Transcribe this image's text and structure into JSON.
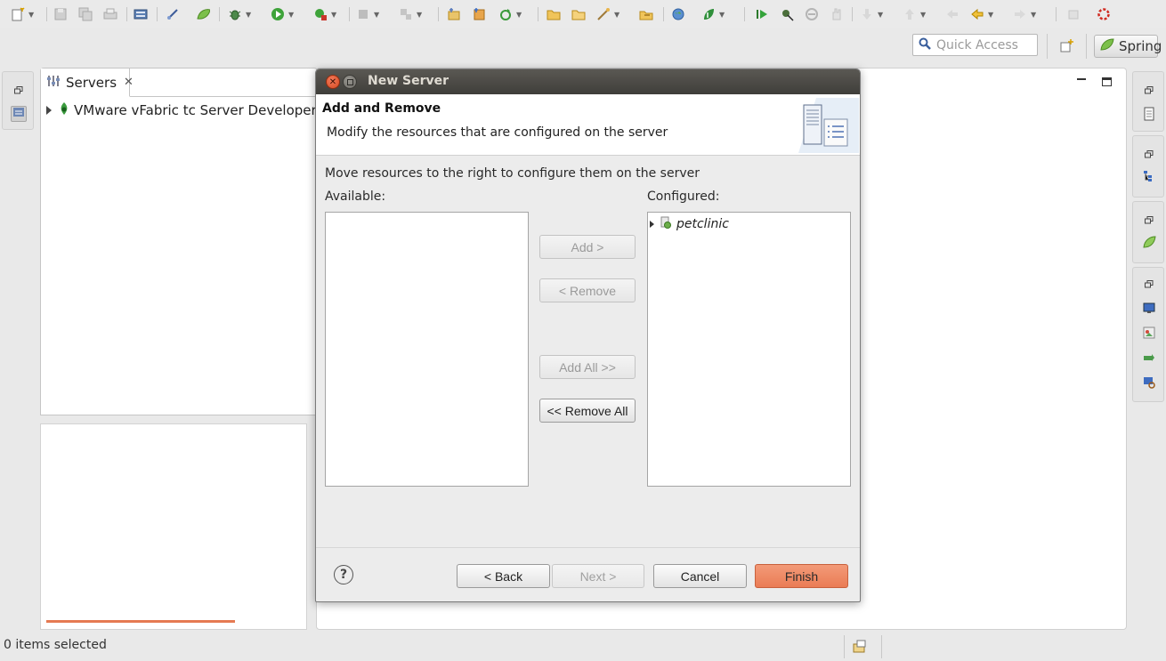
{
  "toolbar": {
    "icons": [
      "new-icon",
      "save-icon",
      "save-all-icon",
      "print-icon",
      "server-icon",
      "link-icon",
      "spring-leaf-icon",
      "debug-icon",
      "run-icon",
      "run-external-icon",
      "stop-icon",
      "disconnect-icon",
      "new-project-icon",
      "new-class-icon",
      "refresh-icon",
      "open-folder-icon",
      "open-type-icon",
      "wand-icon",
      "open-resource-icon",
      "globe-icon",
      "leaf-run-icon",
      "play-icon",
      "skip-icon",
      "cancel-icon",
      "hand-icon",
      "next-annotation-icon",
      "prev-annotation-icon",
      "last-edit-icon",
      "back-icon",
      "forward-icon",
      "pin-icon",
      "spinner-icon"
    ]
  },
  "quick_access": {
    "placeholder": "Quick Access"
  },
  "perspectives": {
    "active_label": "Spring"
  },
  "servers_view": {
    "tab_label": "Servers",
    "server_item": "VMware vFabric tc Server Developer Edition"
  },
  "status_bar": {
    "text": "0 items selected"
  },
  "dialog": {
    "title": "New Server",
    "header_title": "Add and Remove",
    "header_description": "Modify the resources that are configured on the server",
    "instruction": "Move resources to the right to configure them on the server",
    "available_label": "Available:",
    "configured_label": "Configured:",
    "available_items": [],
    "configured_items": [
      {
        "label": "petclinic"
      }
    ],
    "buttons": {
      "add": "Add >",
      "remove": "< Remove",
      "add_all": "Add All >>",
      "remove_all": "<< Remove All",
      "back": "< Back",
      "next": "Next >",
      "cancel": "Cancel",
      "finish": "Finish"
    },
    "help_glyph": "?"
  },
  "colors": {
    "accent_finish": "#ea7c55",
    "titlebar": "#3f3e3a",
    "spring_green": "#6db33f"
  }
}
